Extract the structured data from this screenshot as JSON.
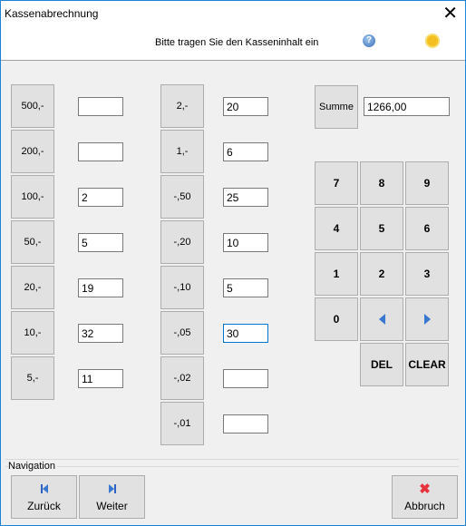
{
  "window": {
    "title": "Kassenabrechnung",
    "close_icon": "close-icon"
  },
  "header": {
    "hint": "Bitte tragen Sie den Kasseninhalt ein",
    "help_icon": "help-icon",
    "sun_icon": "sun-icon"
  },
  "bills": [
    {
      "label": "500,-",
      "value": ""
    },
    {
      "label": "200,-",
      "value": ""
    },
    {
      "label": "100,-",
      "value": "2"
    },
    {
      "label": "50,-",
      "value": "5"
    },
    {
      "label": "20,-",
      "value": "19"
    },
    {
      "label": "10,-",
      "value": "32"
    },
    {
      "label": "5,-",
      "value": "11"
    }
  ],
  "coins": [
    {
      "label": "2,-",
      "value": "20"
    },
    {
      "label": "1,-",
      "value": "6"
    },
    {
      "label": "-,50",
      "value": "25"
    },
    {
      "label": "-,20",
      "value": "10"
    },
    {
      "label": "-,10",
      "value": "5"
    },
    {
      "label": "-,05",
      "value": "30"
    },
    {
      "label": "-,02",
      "value": ""
    },
    {
      "label": "-,01",
      "value": ""
    }
  ],
  "sum": {
    "label": "Summe",
    "value": "1266,00"
  },
  "keypad": {
    "keys": [
      "7",
      "8",
      "9",
      "4",
      "5",
      "6",
      "1",
      "2",
      "3",
      "0"
    ],
    "del": "DEL",
    "clear": "CLEAR"
  },
  "navigation": {
    "label": "Navigation",
    "back": "Zurück",
    "next": "Weiter",
    "cancel": "Abbruch"
  }
}
